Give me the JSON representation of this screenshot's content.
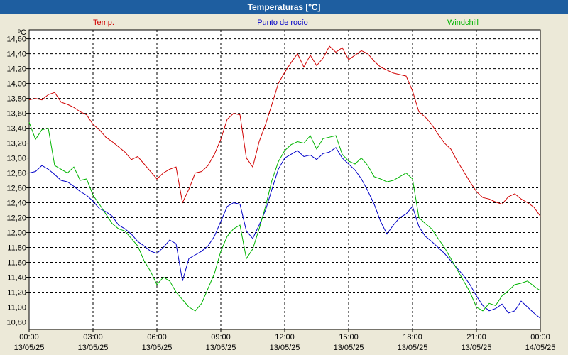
{
  "window": {
    "title": "Temperaturas [ºC]"
  },
  "chart_data": {
    "type": "line",
    "title": "Temperaturas [ºC]",
    "ylabel": "ºC",
    "ylim": [
      10.7,
      14.72
    ],
    "yticks": [
      10.8,
      11.0,
      11.2,
      11.4,
      11.6,
      11.8,
      12.0,
      12.2,
      12.4,
      12.6,
      12.8,
      13.0,
      13.2,
      13.4,
      13.6,
      13.8,
      14.0,
      14.2,
      14.4,
      14.6
    ],
    "xlim": [
      0,
      24
    ],
    "xticks": [
      {
        "t": 0,
        "time": "00:00",
        "date": "13/05/25"
      },
      {
        "t": 3,
        "time": "03:00",
        "date": "13/05/25"
      },
      {
        "t": 6,
        "time": "06:00",
        "date": "13/05/25"
      },
      {
        "t": 9,
        "time": "09:00",
        "date": "13/05/25"
      },
      {
        "t": 12,
        "time": "12:00",
        "date": "13/05/25"
      },
      {
        "t": 15,
        "time": "15:00",
        "date": "13/05/25"
      },
      {
        "t": 18,
        "time": "18:00",
        "date": "13/05/25"
      },
      {
        "t": 21,
        "time": "21:00",
        "date": "13/05/25"
      },
      {
        "t": 24,
        "time": "00:00",
        "date": "14/05/25"
      }
    ],
    "grid": true,
    "legend_position": "top",
    "series": [
      {
        "name": "Temp.",
        "color": "#d00000",
        "x": [
          0,
          0.3,
          0.6,
          0.9,
          1.2,
          1.5,
          1.8,
          2.1,
          2.4,
          2.7,
          3.0,
          3.3,
          3.6,
          3.9,
          4.2,
          4.5,
          4.8,
          5.1,
          5.4,
          5.7,
          6.0,
          6.3,
          6.6,
          6.9,
          7.2,
          7.5,
          7.8,
          8.1,
          8.4,
          8.7,
          9.0,
          9.3,
          9.6,
          9.9,
          10.2,
          10.5,
          10.8,
          11.1,
          11.4,
          11.7,
          12.0,
          12.3,
          12.6,
          12.9,
          13.2,
          13.5,
          13.8,
          14.1,
          14.4,
          14.7,
          15.0,
          15.3,
          15.6,
          15.9,
          16.2,
          16.5,
          16.8,
          17.1,
          17.4,
          17.7,
          18.0,
          18.3,
          18.6,
          18.9,
          19.2,
          19.5,
          19.8,
          20.1,
          20.4,
          20.7,
          21.0,
          21.3,
          21.6,
          21.9,
          22.2,
          22.5,
          22.8,
          23.1,
          23.4,
          23.7,
          24.0
        ],
        "values": [
          13.78,
          13.8,
          13.78,
          13.85,
          13.88,
          13.75,
          13.72,
          13.68,
          13.62,
          13.58,
          13.45,
          13.38,
          13.28,
          13.22,
          13.15,
          13.08,
          12.98,
          13.02,
          12.92,
          12.82,
          12.72,
          12.8,
          12.85,
          12.88,
          12.4,
          12.58,
          12.8,
          12.82,
          12.9,
          13.05,
          13.25,
          13.52,
          13.6,
          13.58,
          13.0,
          12.88,
          13.22,
          13.45,
          13.72,
          14.0,
          14.15,
          14.28,
          14.4,
          14.22,
          14.38,
          14.24,
          14.34,
          14.5,
          14.42,
          14.48,
          14.32,
          14.38,
          14.44,
          14.4,
          14.3,
          14.22,
          14.18,
          14.14,
          14.12,
          14.1,
          13.9,
          13.62,
          13.55,
          13.45,
          13.32,
          13.2,
          13.12,
          12.96,
          12.82,
          12.68,
          12.55,
          12.47,
          12.45,
          12.41,
          12.38,
          12.48,
          12.52,
          12.45,
          12.4,
          12.34,
          12.22
        ]
      },
      {
        "name": "Punto de rocío",
        "color": "#0000c8",
        "x": [
          0,
          0.3,
          0.6,
          0.9,
          1.2,
          1.5,
          1.8,
          2.1,
          2.4,
          2.7,
          3.0,
          3.3,
          3.6,
          3.9,
          4.2,
          4.5,
          4.8,
          5.1,
          5.4,
          5.7,
          6.0,
          6.3,
          6.6,
          6.9,
          7.2,
          7.5,
          7.8,
          8.1,
          8.4,
          8.7,
          9.0,
          9.3,
          9.6,
          9.9,
          10.2,
          10.5,
          10.8,
          11.1,
          11.4,
          11.7,
          12.0,
          12.3,
          12.6,
          12.9,
          13.2,
          13.5,
          13.8,
          14.1,
          14.4,
          14.7,
          15.0,
          15.3,
          15.6,
          15.9,
          16.2,
          16.5,
          16.8,
          17.1,
          17.4,
          17.7,
          18.0,
          18.3,
          18.6,
          18.9,
          19.2,
          19.5,
          19.8,
          20.1,
          20.4,
          20.7,
          21.0,
          21.3,
          21.6,
          21.9,
          22.2,
          22.5,
          22.8,
          23.1,
          23.4,
          23.7,
          24.0
        ],
        "values": [
          12.8,
          12.82,
          12.9,
          12.85,
          12.78,
          12.7,
          12.68,
          12.62,
          12.55,
          12.5,
          12.42,
          12.32,
          12.28,
          12.22,
          12.1,
          12.05,
          11.98,
          11.88,
          11.82,
          11.75,
          11.72,
          11.8,
          11.9,
          11.85,
          11.35,
          11.65,
          11.7,
          11.75,
          11.82,
          11.95,
          12.15,
          12.35,
          12.4,
          12.38,
          12.02,
          11.92,
          12.1,
          12.3,
          12.58,
          12.85,
          13.0,
          13.05,
          13.1,
          13.02,
          13.04,
          12.98,
          13.06,
          13.08,
          13.14,
          13.0,
          12.92,
          12.84,
          12.72,
          12.56,
          12.38,
          12.15,
          11.98,
          12.1,
          12.2,
          12.25,
          12.35,
          12.08,
          11.95,
          11.88,
          11.8,
          11.72,
          11.62,
          11.52,
          11.42,
          11.3,
          11.15,
          11.02,
          10.95,
          10.98,
          11.04,
          10.92,
          10.95,
          11.08,
          11.0,
          10.92,
          10.85
        ]
      },
      {
        "name": "Windchill",
        "color": "#00b400",
        "x": [
          0,
          0.3,
          0.6,
          0.9,
          1.2,
          1.5,
          1.8,
          2.1,
          2.4,
          2.7,
          3.0,
          3.3,
          3.6,
          3.9,
          4.2,
          4.5,
          4.8,
          5.1,
          5.4,
          5.7,
          6.0,
          6.3,
          6.6,
          6.9,
          7.2,
          7.5,
          7.8,
          8.1,
          8.4,
          8.7,
          9.0,
          9.3,
          9.6,
          9.9,
          10.2,
          10.5,
          10.8,
          11.1,
          11.4,
          11.7,
          12.0,
          12.3,
          12.6,
          12.9,
          13.2,
          13.5,
          13.8,
          14.1,
          14.4,
          14.7,
          15.0,
          15.3,
          15.6,
          15.9,
          16.2,
          16.5,
          16.8,
          17.1,
          17.4,
          17.7,
          18.0,
          18.3,
          18.6,
          18.9,
          19.2,
          19.5,
          19.8,
          20.1,
          20.4,
          20.7,
          21.0,
          21.3,
          21.6,
          21.9,
          22.2,
          22.5,
          22.8,
          23.1,
          23.4,
          23.7,
          24.0
        ],
        "values": [
          13.48,
          13.25,
          13.38,
          13.4,
          12.9,
          12.85,
          12.8,
          12.88,
          12.7,
          12.72,
          12.5,
          12.38,
          12.25,
          12.12,
          12.05,
          12.02,
          11.92,
          11.82,
          11.62,
          11.48,
          11.3,
          11.4,
          11.35,
          11.2,
          11.1,
          11.0,
          10.95,
          11.05,
          11.25,
          11.45,
          11.75,
          11.95,
          12.05,
          12.1,
          11.65,
          11.78,
          12.05,
          12.35,
          12.7,
          12.95,
          13.1,
          13.18,
          13.22,
          13.2,
          13.3,
          13.12,
          13.26,
          13.28,
          13.3,
          13.05,
          12.96,
          12.92,
          13.0,
          12.9,
          12.75,
          12.72,
          12.68,
          12.7,
          12.75,
          12.8,
          12.72,
          12.2,
          12.12,
          12.05,
          11.92,
          11.8,
          11.65,
          11.5,
          11.35,
          11.2,
          11.0,
          10.95,
          11.05,
          11.02,
          11.15,
          11.22,
          11.3,
          11.32,
          11.35,
          11.28,
          11.22
        ]
      }
    ]
  }
}
